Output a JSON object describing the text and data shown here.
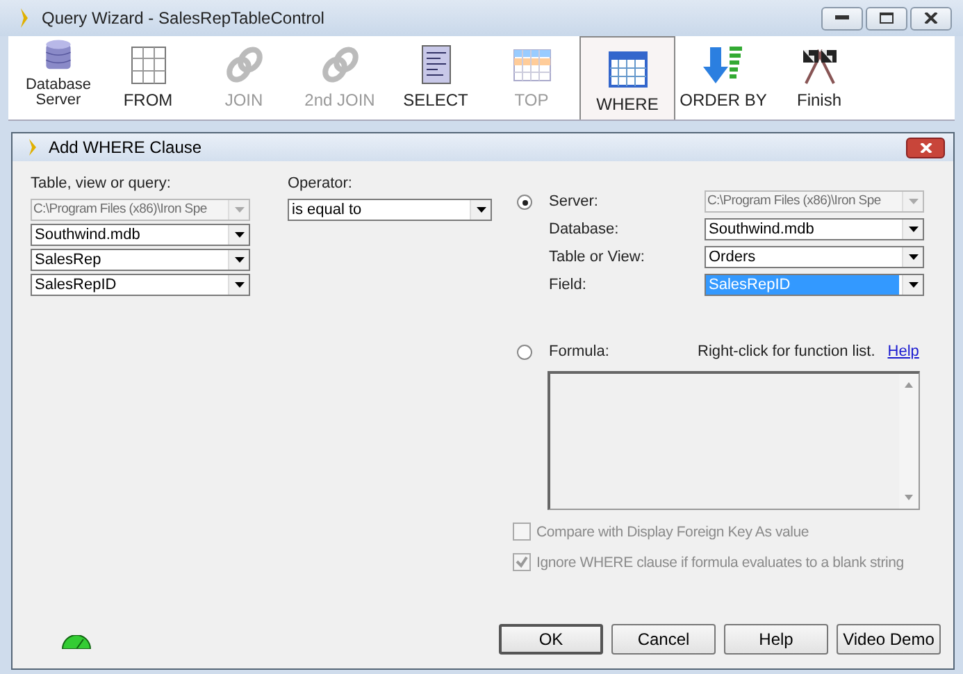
{
  "window": {
    "title": "Query Wizard - SalesRepTableControl"
  },
  "toolbar": [
    {
      "kind": "database",
      "label": "Database Server",
      "disabled": false,
      "selected": false
    },
    {
      "kind": "grid",
      "label": "FROM",
      "disabled": false,
      "selected": false
    },
    {
      "kind": "link",
      "label": "JOIN",
      "disabled": true,
      "selected": false
    },
    {
      "kind": "link",
      "label": "2nd JOIN",
      "disabled": true,
      "selected": false
    },
    {
      "kind": "list",
      "label": "SELECT",
      "disabled": false,
      "selected": false
    },
    {
      "kind": "table",
      "label": "TOP",
      "disabled": true,
      "selected": false
    },
    {
      "kind": "calendar",
      "label": "WHERE",
      "disabled": false,
      "selected": true
    },
    {
      "kind": "sort",
      "label": "ORDER BY",
      "disabled": false,
      "selected": false
    },
    {
      "kind": "flags",
      "label": "Finish",
      "disabled": false,
      "selected": false
    }
  ],
  "dialog": {
    "title": "Add WHERE Clause",
    "source": {
      "label": "Table, view or query:",
      "combos": [
        {
          "value": "C:\\Program Files (x86)\\Iron Spe",
          "disabled": true
        },
        {
          "value": "Southwind.mdb",
          "disabled": false
        },
        {
          "value": "SalesRep",
          "disabled": false
        },
        {
          "value": "SalesRepID",
          "disabled": false
        }
      ]
    },
    "operator": {
      "label": "Operator:",
      "value": "is equal to"
    },
    "field_option": {
      "selected": true,
      "rows": [
        {
          "label": "Server:",
          "value": "C:\\Program Files (x86)\\Iron Spe",
          "disabled": true,
          "focused": false
        },
        {
          "label": "Database:",
          "value": "Southwind.mdb",
          "disabled": false,
          "focused": false
        },
        {
          "label": "Table or View:",
          "value": "Orders",
          "disabled": false,
          "focused": false
        },
        {
          "label": "Field:",
          "value": "SalesRepID",
          "disabled": false,
          "focused": true
        }
      ]
    },
    "formula_option": {
      "selected": false,
      "label": "Formula:",
      "hint": "Right-click for function list.",
      "link": "Help"
    },
    "checkboxes": [
      {
        "label": "Compare with Display Foreign Key As value",
        "checked": false,
        "disabled": true
      },
      {
        "label": "Ignore WHERE clause if formula evaluates to a blank string",
        "checked": true,
        "disabled": true
      }
    ],
    "buttons": [
      "OK",
      "Cancel",
      "Help",
      "Video Demo"
    ]
  }
}
